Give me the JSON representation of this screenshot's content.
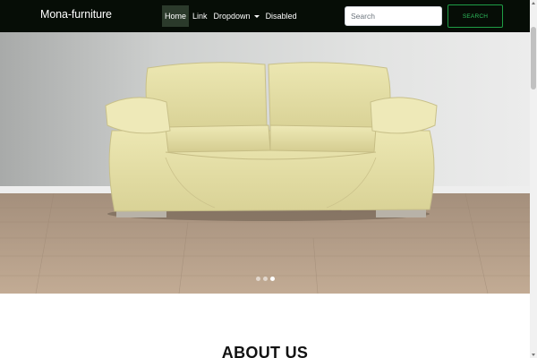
{
  "navbar": {
    "brand": "Mona-furniture",
    "links": [
      {
        "label": "Home",
        "active": true
      },
      {
        "label": "Link",
        "active": false
      },
      {
        "label": "Dropdown",
        "active": false
      },
      {
        "label": "Disabled",
        "active": false
      }
    ],
    "search_placeholder": "Search",
    "search_button": "SEARCH"
  },
  "carousel": {
    "slide_count": 3,
    "active_slide": 3,
    "image_alt": "cream-leather-sofa"
  },
  "about": {
    "title": "ABOUT US"
  },
  "colors": {
    "navbar_bg": "#060d06",
    "search_accent": "#2fbf5e"
  }
}
